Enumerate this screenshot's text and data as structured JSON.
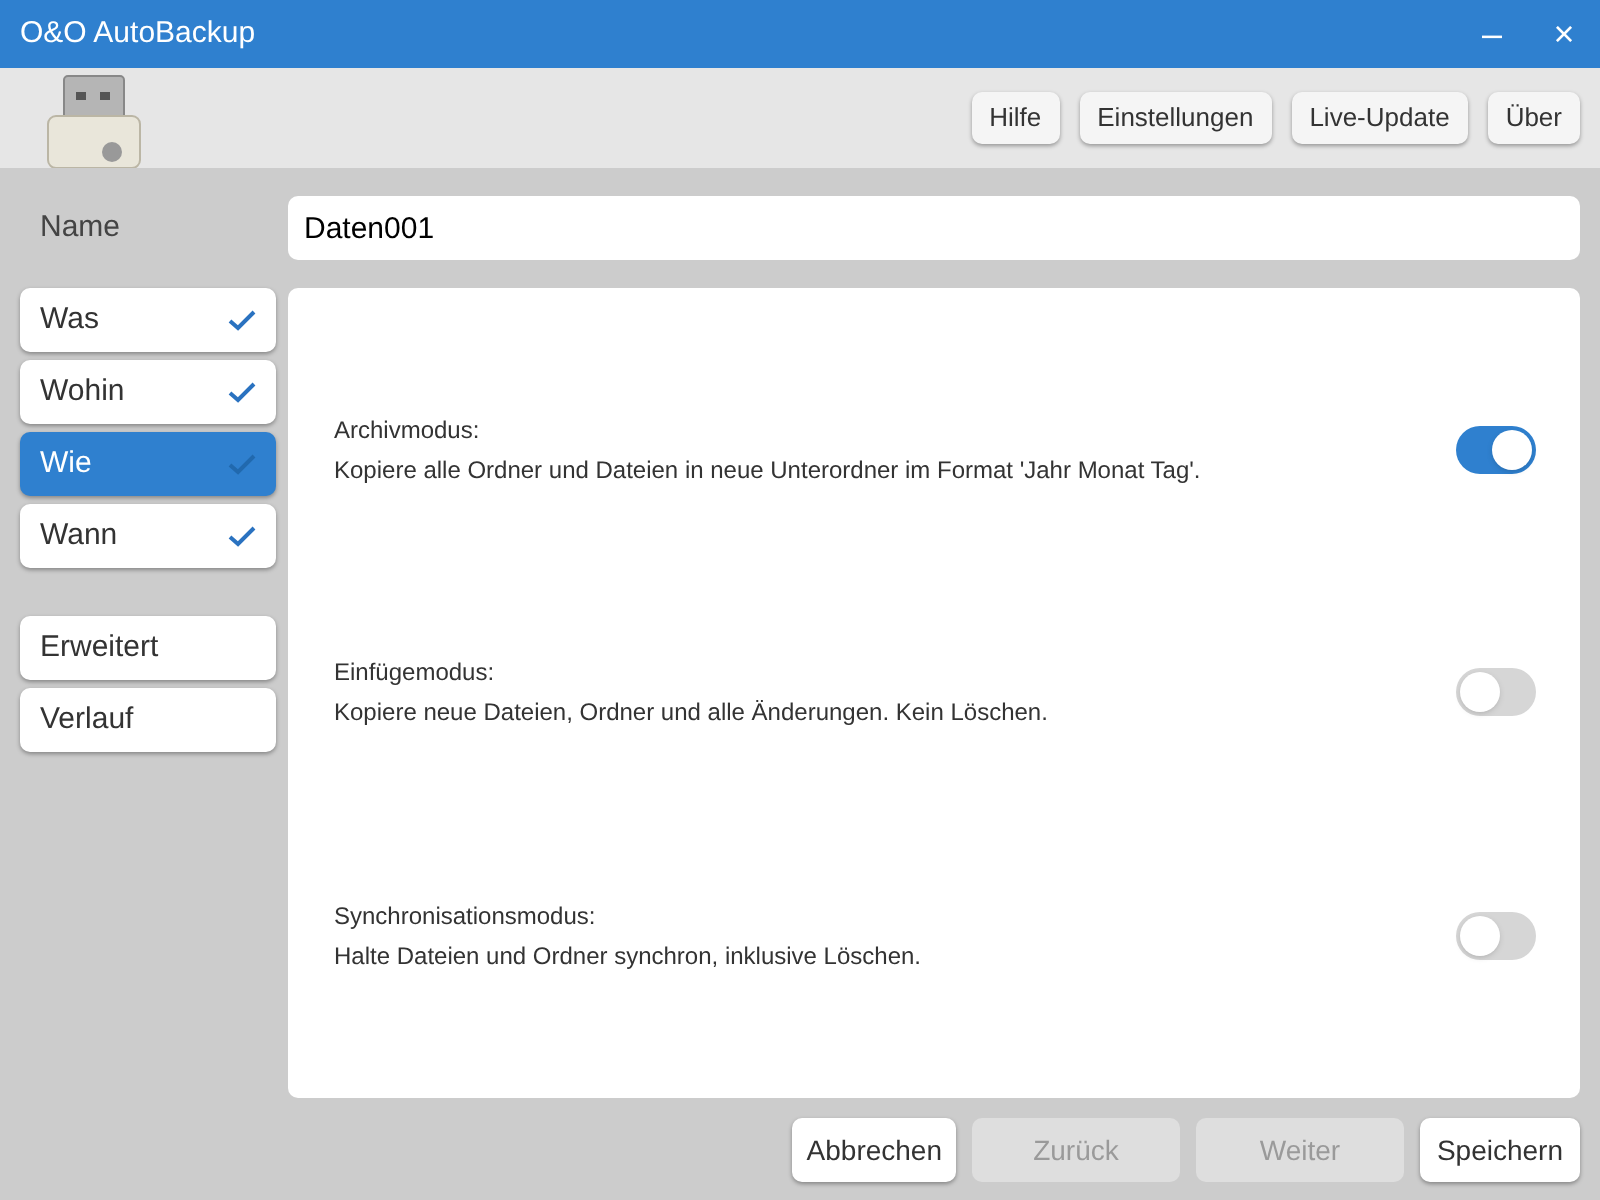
{
  "window": {
    "title": "O&O AutoBackup",
    "controls": [
      "–",
      "×"
    ]
  },
  "toolbar": {
    "buttons": [
      "Hilfe",
      "Einstellungen",
      "Live-Update",
      "Über"
    ]
  },
  "name_field": {
    "label": "Name",
    "value": "Daten001"
  },
  "steps": [
    {
      "label": "Was",
      "checked": true,
      "selected": false
    },
    {
      "label": "Wohin",
      "checked": true,
      "selected": false
    },
    {
      "label": "Wie",
      "checked": true,
      "selected": true
    },
    {
      "label": "Wann",
      "checked": true,
      "selected": false
    }
  ],
  "extras": [
    {
      "label": "Erweitert",
      "selected": false
    },
    {
      "label": "Verlauf",
      "selected": false
    }
  ],
  "modes": [
    {
      "title": "Archivmodus:",
      "description": "Kopiere alle Ordner und Dateien in neue Unterordner im Format 'Jahr Monat Tag'.",
      "on": true
    },
    {
      "title": "Einfügemodus:",
      "description": "Kopiere neue Dateien, Ordner und alle Änderungen. Kein Löschen.",
      "on": false
    },
    {
      "title": "Synchronisationsmodus:",
      "description": "Halte Dateien und Ordner synchron, inklusive Löschen.",
      "on": false
    }
  ],
  "footer": [
    {
      "label": "Abbrechen",
      "disabled": false
    },
    {
      "label": "Zurück",
      "disabled": true
    },
    {
      "label": "Weiter",
      "disabled": true
    },
    {
      "label": "Speichern",
      "disabled": false
    }
  ]
}
